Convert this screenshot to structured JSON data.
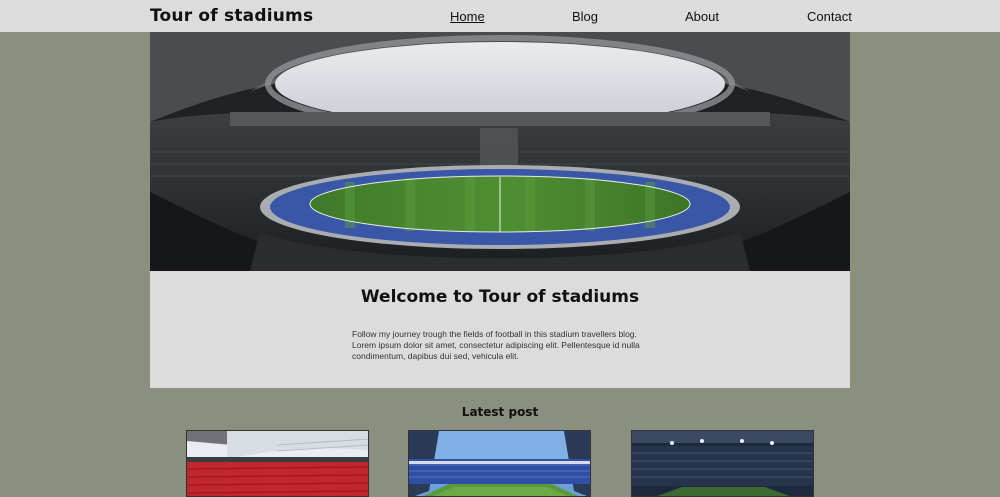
{
  "header": {
    "brand": "Tour of stadiums",
    "nav": [
      {
        "label": "Home",
        "active": true
      },
      {
        "label": "Blog",
        "active": false
      },
      {
        "label": "About",
        "active": false
      },
      {
        "label": "Contact",
        "active": false
      }
    ]
  },
  "hero": {
    "image": "stadium-panorama"
  },
  "welcome": {
    "title": "Welcome to Tour of stadiums",
    "body": "Follow my journey trough the fields of football in this stadium travellers blog. Lorem ipsum dolor sit amet, consectetur adipiscing elit. Pellentesque id nulla condimentum, dapibus dui sed, vehicula elit."
  },
  "latest": {
    "heading": "Latest post",
    "posts": [
      {
        "image": "stadium-red-seats"
      },
      {
        "image": "stadium-blue-seats"
      },
      {
        "image": "stadium-night-lights"
      }
    ]
  },
  "colors": {
    "background": "#8a8f80",
    "panel": "#dcdcdc",
    "text": "#111111"
  }
}
